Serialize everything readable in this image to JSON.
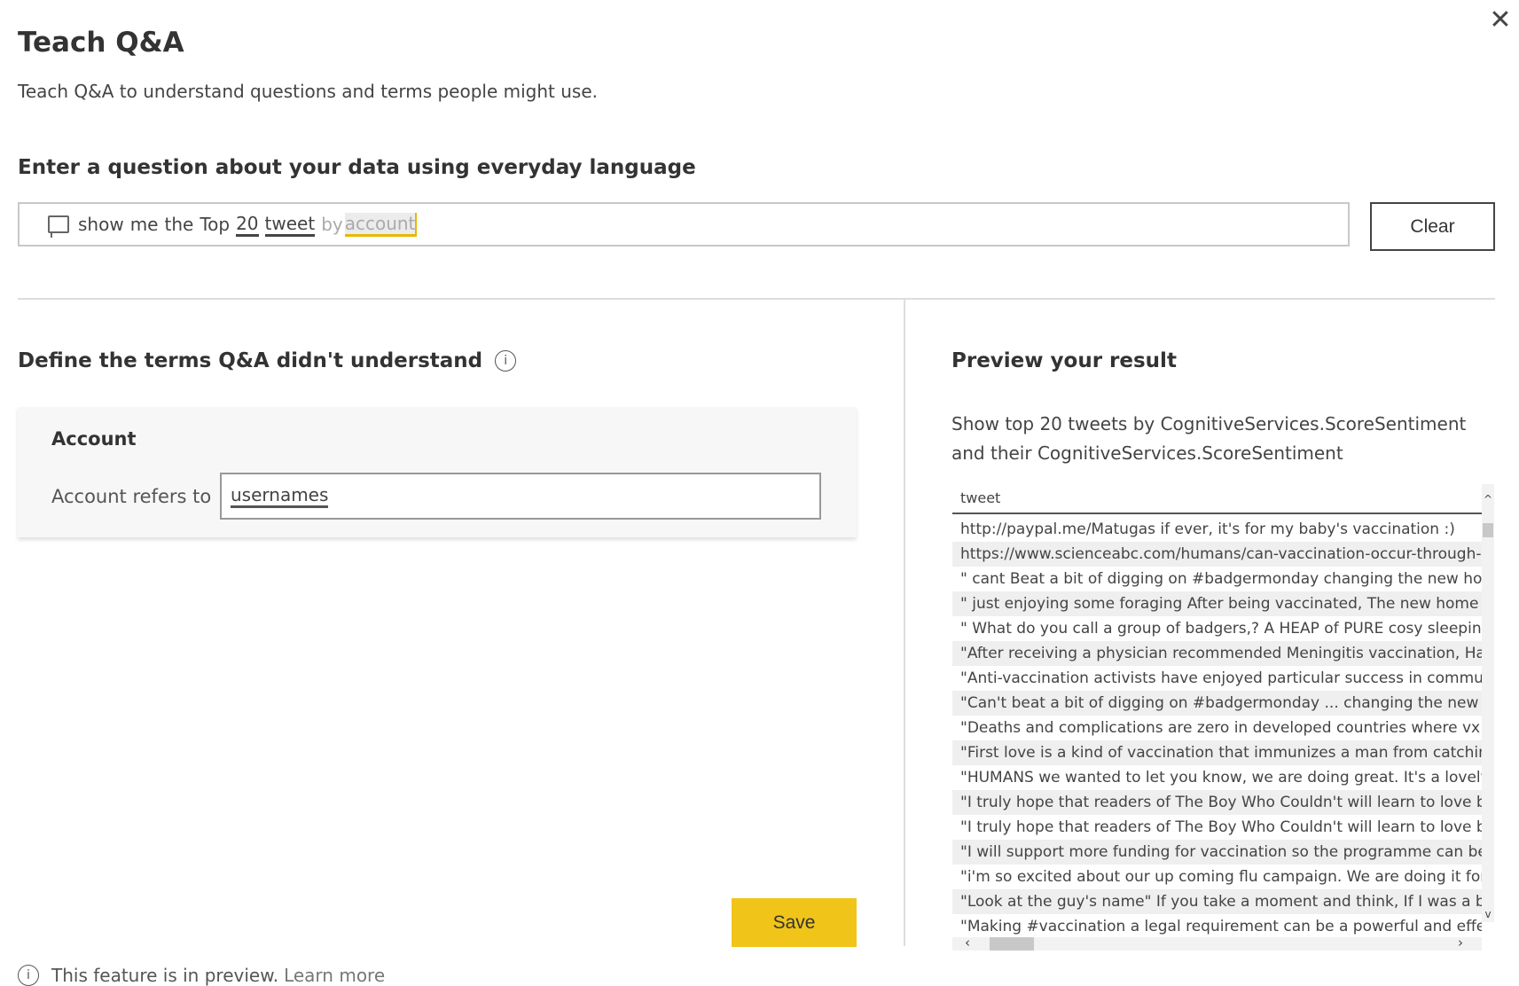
{
  "dialog": {
    "title": "Teach Q&A",
    "subtitle": "Teach Q&A to understand questions and terms people might use.",
    "close_icon": "close-icon"
  },
  "question": {
    "heading": "Enter a question about your data using everyday language",
    "tokens": [
      "show",
      "me",
      "the",
      "Top",
      "20",
      "tweet",
      "by",
      "account"
    ],
    "clear_label": "Clear"
  },
  "define": {
    "heading": "Define the terms Q&A didn't understand",
    "term": "Account",
    "refers_label": "Account refers to",
    "refers_value": "usernames",
    "save_label": "Save"
  },
  "preview": {
    "heading": "Preview your result",
    "description": "Show top 20 tweets by CognitiveServices.ScoreSentiment and their CognitiveServices.ScoreSentiment",
    "table": {
      "column": "tweet",
      "rows": [
        "http://paypal.me/Matugas  if ever, it's for my baby's vaccination :)",
        "https://www.scienceabc.com/humans/can-vaccination-occur-through-dona",
        "\" cant Beat a bit of digging on #badgermonday changing the new house rou",
        "\" just enjoying some foraging After being vaccinated, The new home meets .",
        "\" What do you call a group of badgers,? A HEAP of PURE cosy sleeping HAPI",
        "\"After receiving a physician recommended Meningitis vaccination, Haleigh e",
        "\"Anti-vaccination activists have enjoyed particular success in communities w",
        "\"Can't beat a bit of digging on #badgermonday ... changing the new hou",
        "\"Deaths and complications are zero in developed countries where vx was use",
        "\"First love is a kind of vaccination that immunizes a man from catching the d",
        "\"HUMANS we wanted to let you know, we are doing great.  It's a lovely place",
        "\"I truly hope that readers of The Boy Who Couldn't will learn to love badgers",
        "\"I truly hope that readers of The Boy Who Couldn't will learn to love badgers",
        "\"I will support more funding for vaccination so the programme can be exten",
        "\"i'm so excited about our up coming flu campaign. We are doing it for the ri",
        "\"Look at the guy's name\" If you take a moment and think, If I was a bot and",
        "\"Making #vaccination a legal requirement can be a powerful and effective to"
      ]
    }
  },
  "footer": {
    "text": "This feature is in preview.",
    "link": "Learn more"
  },
  "colors": {
    "accent": "#f0c419",
    "selection_handle": "#e8b800"
  }
}
